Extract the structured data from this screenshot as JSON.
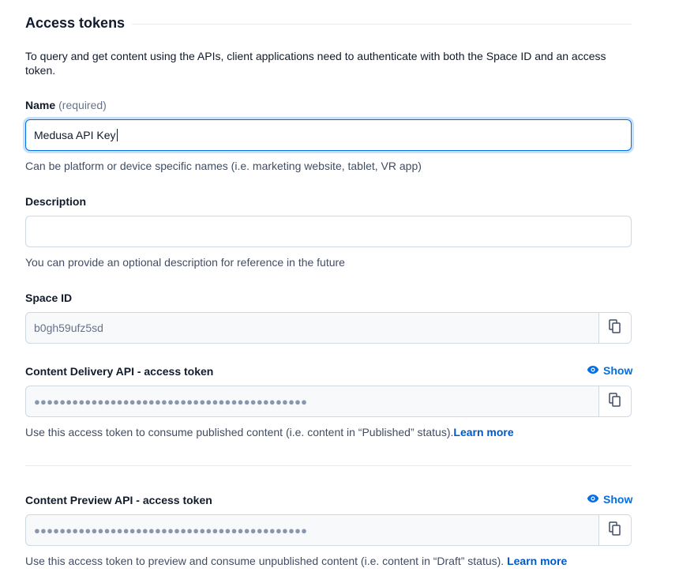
{
  "section": {
    "title": "Access tokens",
    "intro": "To query and get content using the APIs, client applications need to authenticate with both the Space ID and an access token."
  },
  "name_field": {
    "label": "Name",
    "required": "(required)",
    "value": "Medusa API Key",
    "hint": "Can be platform or device specific names (i.e. marketing website, tablet, VR app)"
  },
  "description_field": {
    "label": "Description",
    "value": "",
    "hint": "You can provide an optional description for reference in the future"
  },
  "space_id": {
    "label": "Space ID",
    "value": "b0gh59ufz5sd"
  },
  "delivery_token": {
    "label": "Content Delivery API - access token",
    "show_label": "Show",
    "masked_value": "●●●●●●●●●●●●●●●●●●●●●●●●●●●●●●●●●●●●●●●●●●●",
    "hint": "Use this access token to consume published content (i.e. content in “Published” status).",
    "learn_more": "Learn more"
  },
  "preview_token": {
    "label": "Content Preview API - access token",
    "show_label": "Show",
    "masked_value": "●●●●●●●●●●●●●●●●●●●●●●●●●●●●●●●●●●●●●●●●●●●",
    "hint": "Use this access token to preview and consume unpublished content (i.e. content in “Draft” status).",
    "learn_more": "Learn more"
  },
  "icons": {
    "copy": "copy-icon",
    "eye": "eye-icon"
  },
  "colors": {
    "accent": "#036fe3",
    "link": "#0059c8",
    "border": "#cfd9e0",
    "readonly_bg": "#f7f9fa"
  }
}
